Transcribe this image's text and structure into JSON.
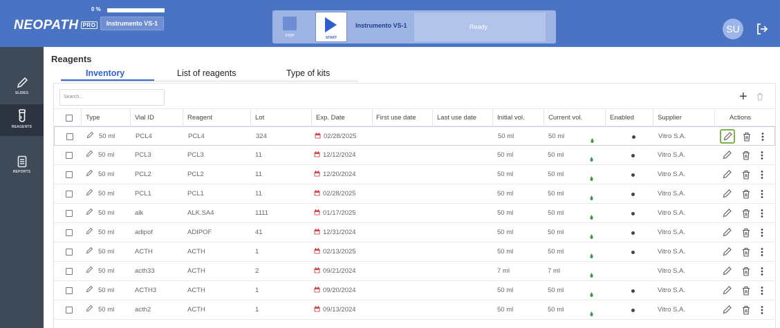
{
  "header": {
    "logo": "NEOPATH",
    "logo_pro": "PRO",
    "progress_label": "0 %",
    "progress_value": 1.0,
    "instrument_chip": "Instrumento VS-1",
    "stop_label": "STOP",
    "start_label": "START",
    "control_instrument": "Instrumento VS-1",
    "control_status": "Ready",
    "avatar_initials": "SU"
  },
  "sidebar": {
    "items": [
      {
        "label": "SLIDES",
        "icon": "slide-pencil-icon",
        "active": false
      },
      {
        "label": "REAGENTS",
        "icon": "vial-icon",
        "active": true
      },
      {
        "label": "REPORTS",
        "icon": "report-icon",
        "active": false
      }
    ]
  },
  "page": {
    "title": "Reagents",
    "tabs": [
      "Inventory",
      "List of reagents",
      "Type of kits"
    ],
    "active_tab": "Inventory",
    "search_placeholder": "Search..."
  },
  "table": {
    "headers": [
      "Type",
      "Vial ID",
      "Reagent",
      "Lot",
      "Exp. Date",
      "First use date",
      "Last use date",
      "Initial vol.",
      "Current vol.",
      "Enabled",
      "Supplier",
      "Actions"
    ],
    "rows": [
      {
        "type": "50 ml",
        "vial_id": "PCL4",
        "reagent": "PCL4",
        "lot": "324",
        "exp_date": "02/28/2025",
        "first_use": "",
        "last_use": "",
        "initial_vol": "50  ml",
        "current_vol": "50  ml",
        "enabled": true,
        "supplier": "Vitro S.A."
      },
      {
        "type": "50 ml",
        "vial_id": "PCL3",
        "reagent": "PCL3",
        "lot": "11",
        "exp_date": "12/12/2024",
        "first_use": "",
        "last_use": "",
        "initial_vol": "50  ml",
        "current_vol": "50  ml",
        "enabled": true,
        "supplier": "Vitro S.A."
      },
      {
        "type": "50 ml",
        "vial_id": "PCL2",
        "reagent": "PCL2",
        "lot": "11",
        "exp_date": "12/20/2024",
        "first_use": "",
        "last_use": "",
        "initial_vol": "50  ml",
        "current_vol": "50  ml",
        "enabled": true,
        "supplier": "Vitro S.A."
      },
      {
        "type": "50 ml",
        "vial_id": "PCL1",
        "reagent": "PCL1",
        "lot": "11",
        "exp_date": "02/28/2025",
        "first_use": "",
        "last_use": "",
        "initial_vol": "50  ml",
        "current_vol": "50  ml",
        "enabled": true,
        "supplier": "Vitro S.A."
      },
      {
        "type": "50 ml",
        "vial_id": "alk",
        "reagent": "ALK.SA4",
        "lot": "1111",
        "exp_date": "01/17/2025",
        "first_use": "",
        "last_use": "",
        "initial_vol": "50  ml",
        "current_vol": "50  ml",
        "enabled": true,
        "supplier": "Vitro S.A."
      },
      {
        "type": "50 ml",
        "vial_id": "adipof",
        "reagent": "ADIPOF",
        "lot": "41",
        "exp_date": "12/31/2024",
        "first_use": "",
        "last_use": "",
        "initial_vol": "50  ml",
        "current_vol": "50  ml",
        "enabled": true,
        "supplier": "Vitro S.A."
      },
      {
        "type": "50 ml",
        "vial_id": "ACTH",
        "reagent": "ACTH",
        "lot": "1",
        "exp_date": "02/13/2025",
        "first_use": "",
        "last_use": "",
        "initial_vol": "50  ml",
        "current_vol": "50  ml",
        "enabled": true,
        "supplier": "Vitro S.A."
      },
      {
        "type": "50 ml",
        "vial_id": "acth33",
        "reagent": "ACTH",
        "lot": "2",
        "exp_date": "09/21/2024",
        "first_use": "",
        "last_use": "",
        "initial_vol": "7  ml",
        "current_vol": "7  ml",
        "enabled": false,
        "supplier": "Vitro S.A."
      },
      {
        "type": "50 ml",
        "vial_id": "ACTH3",
        "reagent": "ACTH",
        "lot": "1",
        "exp_date": "09/20/2024",
        "first_use": "",
        "last_use": "",
        "initial_vol": "50  ml",
        "current_vol": "50  ml",
        "enabled": true,
        "supplier": "Vitro S.A."
      },
      {
        "type": "50 ml",
        "vial_id": "acth2",
        "reagent": "ACTH",
        "lot": "1",
        "exp_date": "09/13/2024",
        "first_use": "",
        "last_use": "",
        "initial_vol": "50  ml",
        "current_vol": "50  ml",
        "enabled": true,
        "supplier": "Vitro S.A."
      }
    ]
  },
  "colors": {
    "brand": "#4a73c4",
    "accent": "#2f5fcf",
    "sidebar": "#3f4a59",
    "calendar": "#d64545",
    "level_drop": "#3d9a4a",
    "edit_highlight": "#79b34a"
  }
}
